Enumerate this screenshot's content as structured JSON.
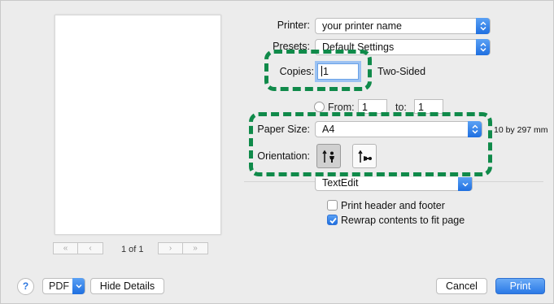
{
  "printer": {
    "label": "Printer:",
    "value": "your printer name"
  },
  "presets": {
    "label": "Presets:",
    "value": "Default Settings"
  },
  "copies": {
    "label": "Copies:",
    "value": "1",
    "two_sided_label": "Two-Sided"
  },
  "pages": {
    "from_label": "From:",
    "from_value": "1",
    "to_label": "to:",
    "to_value": "1"
  },
  "paper_size": {
    "label": "Paper Size:",
    "value": "A4",
    "dimensions": "10 by 297 mm"
  },
  "orientation": {
    "label": "Orientation:"
  },
  "app_menu": {
    "value": "TextEdit"
  },
  "options": {
    "print_header_footer": {
      "label": "Print header and footer",
      "checked": false
    },
    "rewrap_contents": {
      "label": "Rewrap contents to fit page",
      "checked": true
    }
  },
  "preview": {
    "page_count": "1 of 1",
    "first_label": "«",
    "prev_label": "‹",
    "next_label": "›",
    "last_label": "»"
  },
  "footer": {
    "help_label": "?",
    "pdf_label": "PDF",
    "hide_details_label": "Hide Details",
    "cancel_label": "Cancel",
    "print_label": "Print"
  },
  "colors": {
    "accent": "#2b79e6",
    "highlight": "#108a4a"
  },
  "icons": [
    "chevron-updown-icon",
    "chevron-down-icon",
    "portrait-orientation-icon",
    "landscape-orientation-icon",
    "checkmark-icon",
    "help-icon"
  ]
}
